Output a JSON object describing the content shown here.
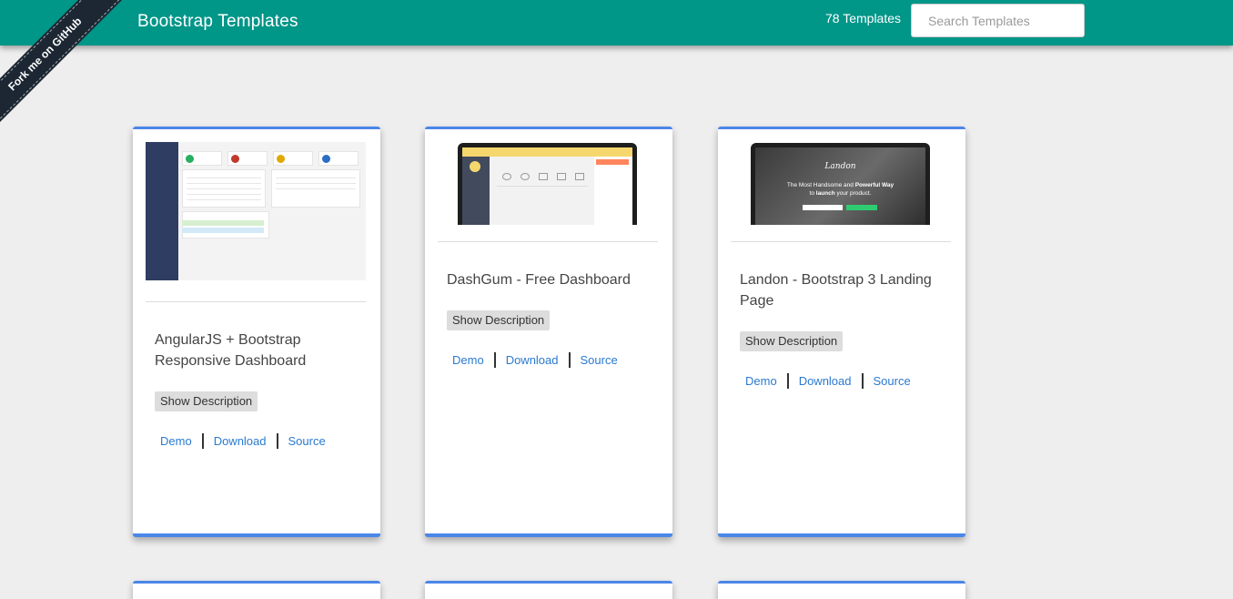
{
  "header": {
    "brand": "Bootstrap Templates",
    "template_count": "78 Templates",
    "search_placeholder": "Search Templates"
  },
  "ribbon": {
    "label": "Fork me on GitHub"
  },
  "cards": [
    {
      "title": "AngularJS + Bootstrap Responsive Dashboard",
      "show_description": "Show Description",
      "links": {
        "demo": "Demo",
        "download": "Download",
        "source": "Source"
      }
    },
    {
      "title": "DashGum - Free Dashboard",
      "show_description": "Show Description",
      "links": {
        "demo": "Demo",
        "download": "Download",
        "source": "Source"
      }
    },
    {
      "title": "Landon - Bootstrap 3 Landing Page",
      "show_description": "Show Description",
      "links": {
        "demo": "Demo",
        "download": "Download",
        "source": "Source"
      },
      "thumbnail_text": {
        "logo": "Landon",
        "headline_prefix": "The Most Handsome and ",
        "headline_bold": "Powerful Way",
        "subline_prefix": "to ",
        "subline_bold": "launch",
        "subline_suffix": " your product."
      }
    }
  ],
  "colors": {
    "navbar": "#009688",
    "card_accent": "#4a86e8",
    "link": "#2a7ad0",
    "background": "#eeeeee"
  }
}
